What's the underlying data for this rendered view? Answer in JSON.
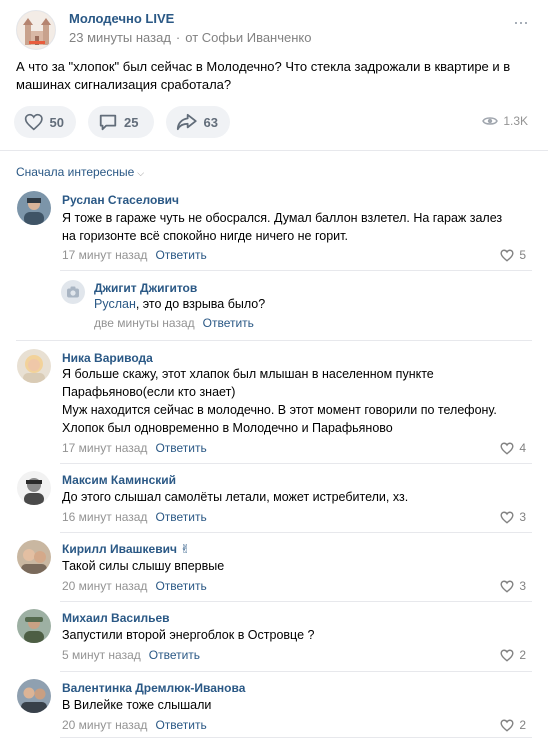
{
  "post": {
    "group_name": "Молодечно LIVE",
    "time": "23 минуты назад",
    "separator": "·",
    "author": "от Софьи Иванченко",
    "text": "А что за \"хлопок\" был сейчас в Молодечно? Что стекла задрожали в квартире и в машинах сигнализация сработала?",
    "likes": "50",
    "comments": "25",
    "shares": "63",
    "views": "1.3K"
  },
  "sort_label": "Сначала интересные",
  "reply_label": "Ответить",
  "comments": [
    {
      "name": "Руслан Стаселович",
      "text": "Я тоже в гараже чуть не обосрался. Думал баллон взлетел. На гараж залез\nна горизонте всё спокойно нигде ничего не горит.",
      "time": "17 минут назад",
      "likes": "5"
    },
    {
      "name": "Джигит Джигитов",
      "reply_to": "Руслан",
      "text": ", это до взрыва было?",
      "time": "две минуты назад",
      "likes": ""
    },
    {
      "name": "Ника Варивода",
      "text": "Я больше скажу, этот хлапок был млышан в населенном пункте\nПарафьяново(если кто знает)\nМуж находится сейчас в молодечно. В этот момент говорили по телефону.\nХлопок был одновременно в Молодечно и Парафьяново",
      "time": "17 минут назад",
      "likes": "4"
    },
    {
      "name": "Максим Каминский",
      "text": "До этого слышал самолёты летали, может истребители, хз.",
      "time": "16 минут назад",
      "likes": "3"
    },
    {
      "name": "Кирилл Ивашкевич",
      "text": "Такой силы слышу впервые",
      "time": "20 минут назад",
      "likes": "3"
    },
    {
      "name": "Михаил Васильев",
      "text": "Запустили второй энергоблок в Островце ?",
      "time": "5 минут назад",
      "likes": "2"
    },
    {
      "name": "Валентинка Дремлюк-Иванова",
      "text": "В Вилейке тоже слышали",
      "time": "20 минут назад",
      "likes": "2"
    }
  ],
  "colors": {
    "link": "#2a5885",
    "meta": "#939393",
    "button_bg": "#f0f2f5"
  }
}
